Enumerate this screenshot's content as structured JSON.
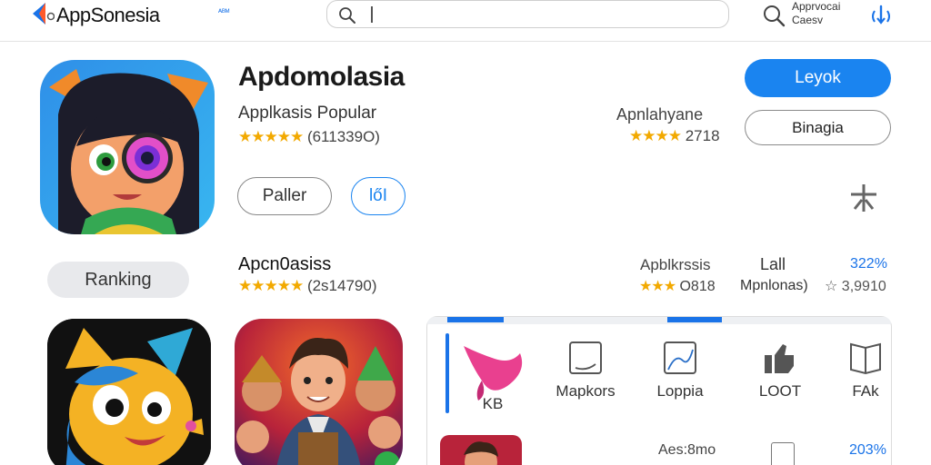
{
  "header": {
    "brand": "AppSonesia",
    "brand_sup": "ᴬᴮᴹ",
    "search_placeholder": "",
    "account_line1": "Apprvocai",
    "account_line2": "Caesv"
  },
  "featured": {
    "title": "Apdomolasia",
    "subtitle": "Applkasis Popular",
    "stars": "★★★★★",
    "rating_text": "(611339O)",
    "mid_label": "Apnlahyane",
    "mid_stars": "★★★★",
    "mid_rating_text": "2718",
    "primary_button": "Leyok",
    "secondary_button": "Binagia",
    "pill_button": "Paller",
    "icon_button": "lőI"
  },
  "ranking": {
    "pill_label": "Ranking",
    "title": "Apcn0asiss",
    "stars": "★★★★★",
    "rating_text": "(2s14790)",
    "mid_label": "Apblkrssis",
    "mid_stars": "★★★",
    "mid_rating_text": "O818",
    "col_top": "Lall",
    "col_bottom": "Mpnlonas)",
    "percent": "322%",
    "count_star": "☆",
    "count": "3,9910"
  },
  "categories": [
    {
      "label": "KB",
      "icon": "pink-shape-icon"
    },
    {
      "label": "Mapkors",
      "icon": "picture-frame-icon"
    },
    {
      "label": "Loppia",
      "icon": "chart-frame-icon"
    },
    {
      "label": "LOOT",
      "icon": "thumbs-up-icon"
    },
    {
      "label": "FAk",
      "icon": "book-icon"
    }
  ],
  "panel_row2": {
    "label": "Aes:8mo",
    "percent": "203%"
  },
  "colors": {
    "accent": "#1a84f0",
    "star": "#f2a900",
    "pill_bg": "#e8e9ec"
  }
}
